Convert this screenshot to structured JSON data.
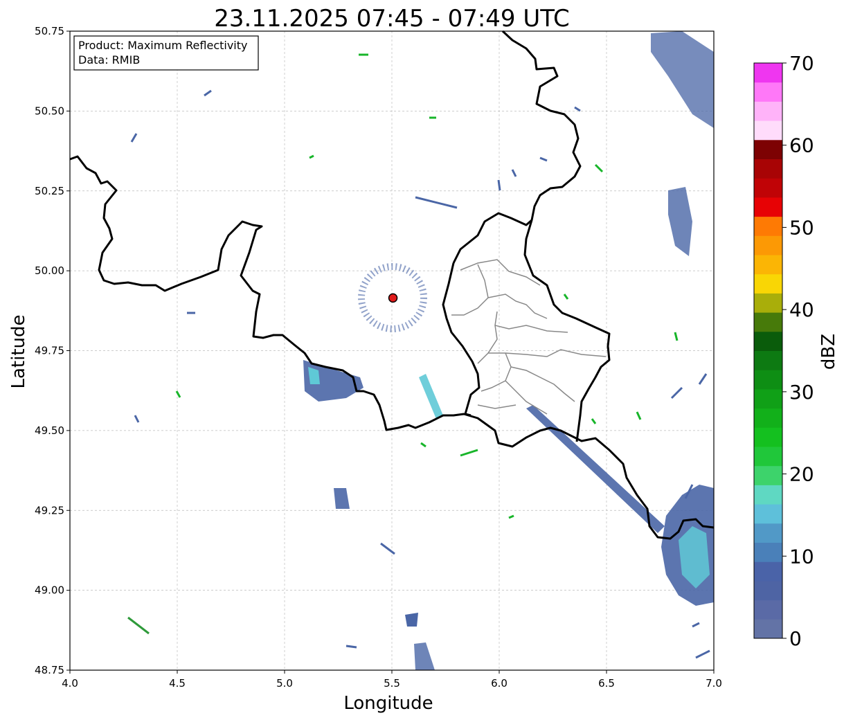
{
  "title": "23.11.2025 07:45 - 07:49 UTC",
  "xlabel": "Longitude",
  "ylabel": "Latitude",
  "info_box": {
    "line1": "Product: Maximum Reflectivity",
    "line2": "Data: RMIB"
  },
  "colorbar": {
    "label": "dBZ",
    "ticks": [
      "0",
      "10",
      "20",
      "30",
      "40",
      "50",
      "60",
      "70"
    ],
    "range": [
      0,
      70
    ],
    "colors": [
      "#6373a6",
      "#5a6aa6",
      "#4e64a4",
      "#4a63a8",
      "#4a80b9",
      "#5199c7",
      "#5ec0da",
      "#5fd8c2",
      "#3dd36b",
      "#20c73a",
      "#14c01f",
      "#12b01a",
      "#10a017",
      "#0e8e14",
      "#0d7a12",
      "#0a5c0b",
      "#477a0a",
      "#a9ae0a",
      "#f9d605",
      "#fbb505",
      "#fc9905",
      "#fe7a04",
      "#e70205",
      "#c00306",
      "#a80405",
      "#7d0203",
      "#ffdcfb",
      "#ffb3f9",
      "#ff78f8",
      "#ef36f0"
    ]
  },
  "xticks": [
    "4.0",
    "4.5",
    "5.0",
    "5.5",
    "6.0",
    "6.5",
    "7.0"
  ],
  "yticks": [
    "48.75",
    "49.00",
    "49.25",
    "49.50",
    "49.75",
    "50.00",
    "50.25",
    "50.50",
    "50.75"
  ],
  "map": {
    "lon_range": [
      4.0,
      7.0
    ],
    "lat_range": [
      48.75,
      50.75
    ],
    "grid": true,
    "radar_site": {
      "lon": 5.505,
      "lat": 49.915,
      "color": "#e01b1b"
    },
    "echo_colors": {
      "weak": "#4a66a6",
      "medium": "#5fc9d6",
      "strong": "#18b52a"
    }
  }
}
